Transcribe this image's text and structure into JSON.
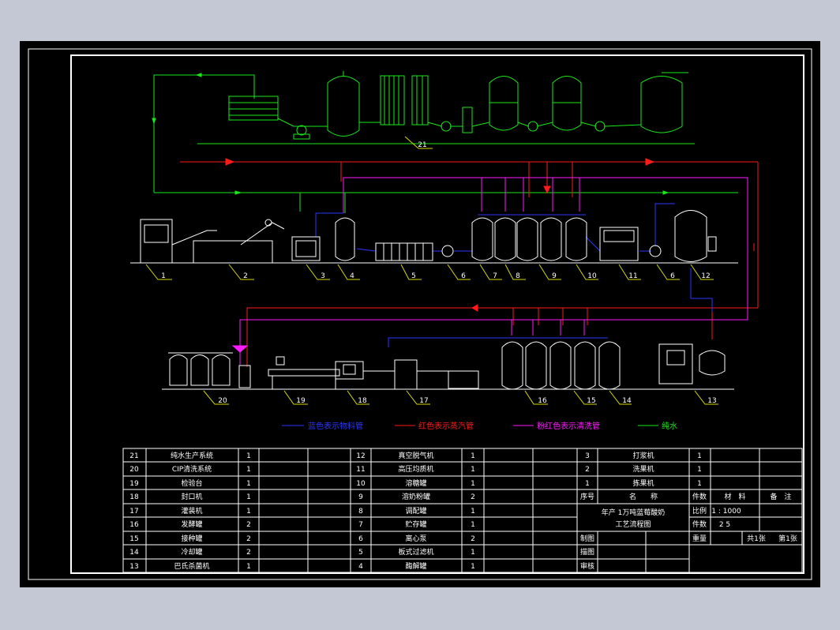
{
  "drawing": {
    "legend": [
      {
        "text": "蓝色表示物料管",
        "color": "#2b36ff"
      },
      {
        "text": "红色表示蒸汽管",
        "color": "#ff1a1a"
      },
      {
        "text": "粉红色表示清洗管",
        "color": "#ff1aff"
      },
      {
        "text": "纯水",
        "color": "#18e818"
      }
    ],
    "equipment_numbers": {
      "top_row": [
        "1",
        "2",
        "3",
        "4",
        "5",
        "6",
        "7",
        "8",
        "9",
        "10",
        "11",
        "6",
        "12"
      ],
      "bottom_row": [
        "20",
        "19",
        "18",
        "17",
        "16",
        "15",
        "14",
        "13"
      ],
      "water": "21"
    }
  },
  "parts_table": {
    "col1": [
      {
        "no": "21",
        "name": "纯水生产系统",
        "qty": "1"
      },
      {
        "no": "20",
        "name": "CIP清洗系统",
        "qty": "1"
      },
      {
        "no": "19",
        "name": "检验台",
        "qty": "1"
      },
      {
        "no": "18",
        "name": "封口机",
        "qty": "1"
      },
      {
        "no": "17",
        "name": "灌装机",
        "qty": "1"
      },
      {
        "no": "16",
        "name": "发酵罐",
        "qty": "2"
      },
      {
        "no": "15",
        "name": "接种罐",
        "qty": "2"
      },
      {
        "no": "14",
        "name": "冷却罐",
        "qty": "2"
      },
      {
        "no": "13",
        "name": "巴氏杀菌机",
        "qty": "1"
      }
    ],
    "col2": [
      {
        "no": "12",
        "name": "真空脱气机",
        "qty": "1"
      },
      {
        "no": "11",
        "name": "高压均质机",
        "qty": "1"
      },
      {
        "no": "10",
        "name": "溶糖罐",
        "qty": "1"
      },
      {
        "no": "9",
        "name": "溶奶粉罐",
        "qty": "2"
      },
      {
        "no": "8",
        "name": "调配罐",
        "qty": "1"
      },
      {
        "no": "7",
        "name": "贮存罐",
        "qty": "1"
      },
      {
        "no": "6",
        "name": "离心泵",
        "qty": "2"
      },
      {
        "no": "5",
        "name": "板式过滤机",
        "qty": "1"
      },
      {
        "no": "4",
        "name": "酶解罐",
        "qty": "1"
      }
    ],
    "col3": [
      {
        "no": "3",
        "name": "打浆机",
        "qty": "1"
      },
      {
        "no": "2",
        "name": "洗果机",
        "qty": "1"
      },
      {
        "no": "1",
        "name": "拣果机",
        "qty": "1"
      }
    ],
    "header": {
      "seq": "序号",
      "name": "名　　称",
      "qty": "件数",
      "material": "材　料",
      "remark": "备　注"
    }
  },
  "title_block": {
    "title_line1": "年产 1万吨蓝莓酸奶",
    "title_line2": "工艺流程图",
    "scale_label": "比例",
    "scale_value": "1 : 1000",
    "count_label": "件数",
    "count_value": "2 5",
    "weight_label": "重量",
    "sheets_total": "共1张",
    "sheet_no": "第1张",
    "drawn_label": "制图",
    "traced_label": "描图",
    "checked_label": "审核"
  },
  "colors": {
    "blue": "#2b36ff",
    "red": "#ff1a1a",
    "pink": "#ff1aff",
    "green": "#18e818",
    "yellow": "#d8d800",
    "white": "#ffffff"
  }
}
